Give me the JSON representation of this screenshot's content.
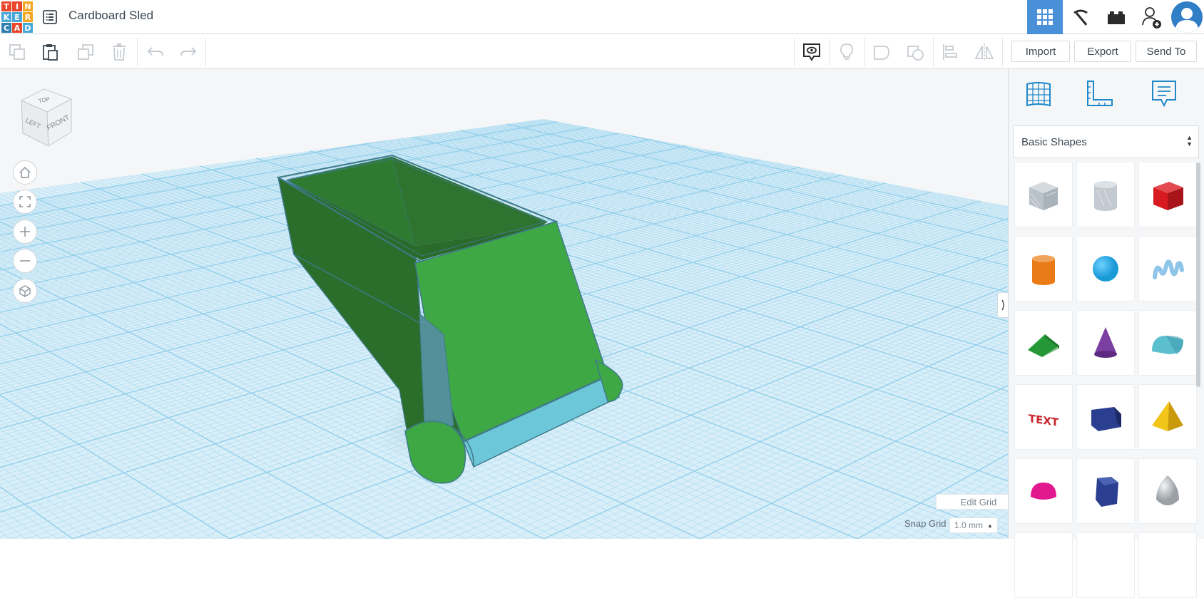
{
  "app": {
    "logo_letters": [
      "T",
      "I",
      "N",
      "K",
      "E",
      "R",
      "C",
      "A",
      "D"
    ],
    "logo_colors": [
      "#e8472b",
      "#e8472b",
      "#f5a623",
      "#4aa8d8",
      "#4aa8d8",
      "#f5a623",
      "#2e7fb0",
      "#e8472b",
      "#4aa8d8"
    ],
    "document_title": "Cardboard Sled"
  },
  "header": {
    "buttons": [
      {
        "name": "3d-design",
        "icon": "grid-icon",
        "active": true
      },
      {
        "name": "codeblocks",
        "icon": "pickaxe-icon",
        "active": false
      },
      {
        "name": "bricks",
        "icon": "brick-icon",
        "active": false
      },
      {
        "name": "invite-user",
        "icon": "add-user-icon",
        "active": false
      },
      {
        "name": "profile",
        "icon": "avatar-icon",
        "active": false
      }
    ]
  },
  "toolbar": {
    "left_tools": [
      "copy-icon",
      "paste-icon",
      "duplicate-icon",
      "delete-icon",
      "undo-icon",
      "redo-icon"
    ],
    "right_tools": [
      "notes-icon",
      "lightbulb-icon",
      "group-icon",
      "ungroup-icon",
      "align-icon",
      "mirror-icon"
    ],
    "import_label": "Import",
    "export_label": "Export",
    "send_to_label": "Send To"
  },
  "viewcube": {
    "top_label": "TOP",
    "left_label": "LEFT",
    "front_label": "FRONT"
  },
  "nav_controls": [
    "home-icon",
    "fit-view-icon",
    "zoom-in-icon",
    "zoom-out-icon",
    "perspective-icon"
  ],
  "grid": {
    "edit_grid_label": "Edit Grid",
    "snap_grid_label": "Snap Grid",
    "snap_grid_value": "1.0 mm"
  },
  "panel": {
    "view_tabs": [
      "workplane-icon",
      "ruler-icon",
      "notes-icon"
    ],
    "shape_category": "Basic Shapes",
    "shapes": [
      {
        "name": "box-hole",
        "color": "#b9c1c9"
      },
      {
        "name": "cylinder-hole",
        "color": "#c3cad1"
      },
      {
        "name": "box",
        "color": "#d71920"
      },
      {
        "name": "cylinder",
        "color": "#ea7b17"
      },
      {
        "name": "sphere",
        "color": "#1a9bd7"
      },
      {
        "name": "scribble",
        "color": "#8ec5e8"
      },
      {
        "name": "roof",
        "color": "#2aa43d"
      },
      {
        "name": "cone",
        "color": "#7b3ea1"
      },
      {
        "name": "round-roof",
        "color": "#5cbfcf"
      },
      {
        "name": "text",
        "color": "#c8262d"
      },
      {
        "name": "wedge",
        "color": "#2a3f8f"
      },
      {
        "name": "pyramid",
        "color": "#f2c51b"
      },
      {
        "name": "half-sphere",
        "color": "#e2188f"
      },
      {
        "name": "polygon",
        "color": "#2a3f8f"
      },
      {
        "name": "paraboloid",
        "color": "#c9ccd0"
      }
    ]
  },
  "colors": {
    "accent": "#4a90d9",
    "workplane": "#d8eef8",
    "grid_line": "#8cccea",
    "model_green": "#3aa744",
    "model_dark_green": "#2b6e2c",
    "model_blue": "#6cc7d9"
  }
}
